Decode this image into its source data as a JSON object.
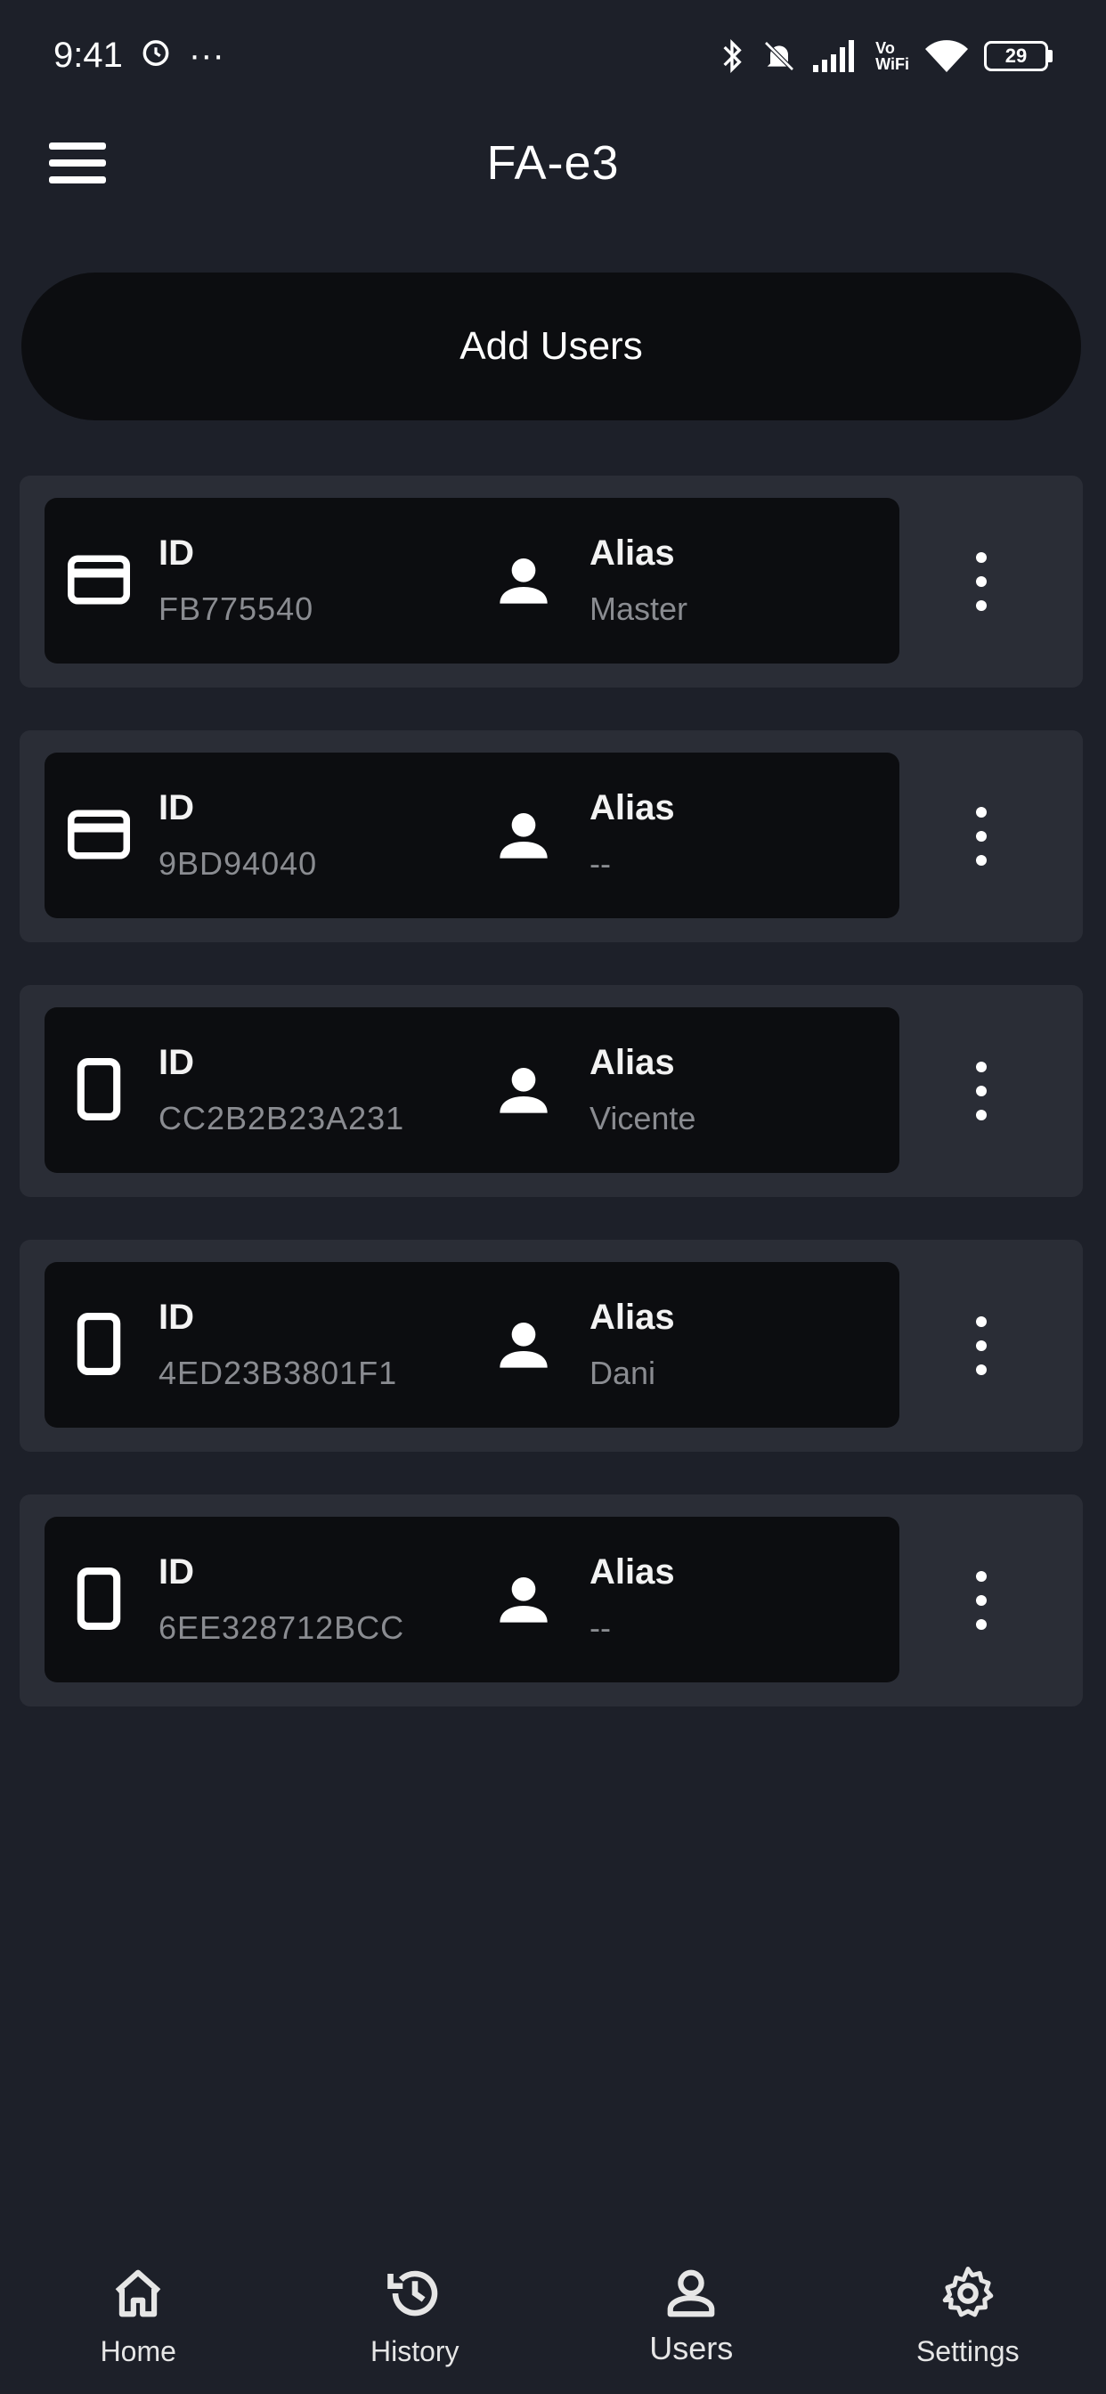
{
  "status_bar": {
    "time": "9:41",
    "more": "···",
    "icons": [
      "alarm-icon",
      "bluetooth-icon",
      "mute-icon",
      "signal-icon",
      "volte-icon",
      "wifi-icon",
      "battery-icon"
    ],
    "volte_label": "Vo\nWiFi",
    "battery_level": "29"
  },
  "app_bar": {
    "menu_icon": "menu-icon",
    "title": "FA-e3"
  },
  "add_users_label": "Add Users",
  "users": [
    {
      "type": "card-icon",
      "id_label": "ID",
      "id_value": "FB775540",
      "alias_label": "Alias",
      "alias_value": "Master"
    },
    {
      "type": "card-icon",
      "id_label": "ID",
      "id_value": "9BD94040",
      "alias_label": "Alias",
      "alias_value": "--"
    },
    {
      "type": "phone-icon",
      "id_label": "ID",
      "id_value": "CC2B2B23A231",
      "alias_label": "Alias",
      "alias_value": "Vicente"
    },
    {
      "type": "phone-icon",
      "id_label": "ID",
      "id_value": "4ED23B3801F1",
      "alias_label": "Alias",
      "alias_value": "Dani"
    },
    {
      "type": "phone-icon",
      "id_label": "ID",
      "id_value": "6EE328712BCC",
      "alias_label": "Alias",
      "alias_value": "--"
    }
  ],
  "bottom_nav": [
    {
      "label": "Home",
      "icon": "home-icon"
    },
    {
      "label": "History",
      "icon": "history-icon"
    },
    {
      "label": "Users",
      "icon": "users-icon",
      "active": true
    },
    {
      "label": "Settings",
      "icon": "settings-icon"
    }
  ],
  "colors": {
    "background": "#1d2029",
    "card_outer": "#2a2d36",
    "card_inner": "#0c0d10",
    "text_primary": "#f2f2f2",
    "text_secondary": "#8a8c91"
  }
}
